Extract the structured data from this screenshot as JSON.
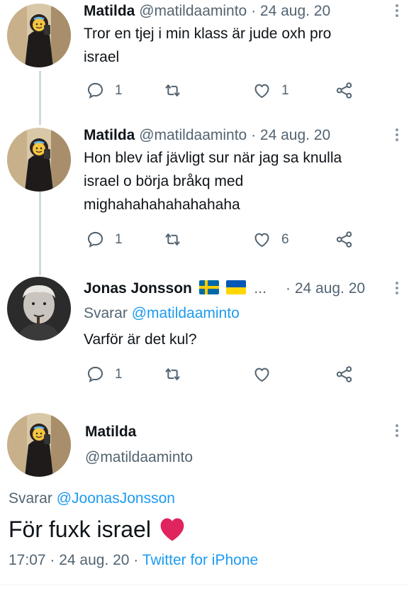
{
  "tweets": [
    {
      "name": "Matilda",
      "handle": "@matildaaminto",
      "date": "· 24 aug. 20",
      "lines": [
        "Tror en tjej i min klass är jude oxh pro",
        "israel"
      ],
      "reply_count": "1",
      "retweet_count": "",
      "like_count": "1"
    },
    {
      "name": "Matilda",
      "handle": "@matildaaminto",
      "date": "· 24 aug. 20",
      "lines": [
        "Hon blev iaf jävligt sur när jag sa knulla",
        "israel o börja bråkq med",
        "mighahahahahahahaha"
      ],
      "reply_count": "1",
      "retweet_count": "",
      "like_count": "6"
    },
    {
      "name": "Jonas Jonsson",
      "ellipsis": "...",
      "date": "· 24 aug. 20",
      "replying_prefix": "Svarar",
      "replying_to": "@matildaaminto",
      "lines": [
        "Varför är det kul?"
      ],
      "reply_count": "1",
      "retweet_count": "",
      "like_count": ""
    }
  ],
  "focus": {
    "name": "Matilda",
    "handle": "@matildaaminto",
    "replying_prefix": "Svarar",
    "replying_to": "@JoonasJonsson",
    "text": "För fuxk israel",
    "time": "17:07 · 24 aug. 20 ·",
    "source": "Twitter for iPhone"
  },
  "icons": {
    "reply": "reply-icon",
    "retweet": "retweet-icon",
    "like": "heart-icon",
    "share": "share-icon",
    "more": "more-vertical-icon",
    "emoji_heart": "red-heart-emoji",
    "flag_1": "sweden-flag",
    "flag_2": "ukraine-flag"
  },
  "colors": {
    "accent": "#1d9bf0",
    "muted": "#536471",
    "heart": "#e0245e"
  }
}
